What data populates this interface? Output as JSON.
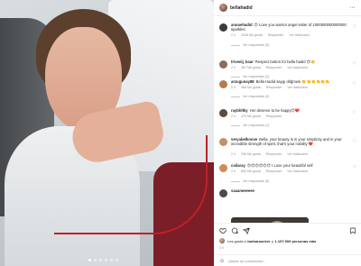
{
  "post": {
    "username": "bellahadid",
    "image_carousel": {
      "current": 1,
      "total": 6
    }
  },
  "colors": {
    "accent": "#0095f6",
    "muted": "#8e8e8e",
    "text": "#262626",
    "heart_red": "#ed4956"
  },
  "comments": [
    {
      "username": "anouehadid",
      "text": "😍 Love you warrior angel sister of 1000000000000000 sparkles",
      "time": "2 h",
      "likes": "2046 Me gusta",
      "reply": "Responder",
      "translate": "Ver traducción",
      "replies": "Ver respuestas (5)",
      "avatar_color": "#3b3b3b"
    },
    {
      "username": "trivenij_kaur",
      "text": "Respect button for bella hadid 😍👏",
      "time": "2 h",
      "likes": "487 Me gusta",
      "reply": "Responder",
      "translate": "Ver traducción",
      "replies": "Ver respuestas (2)",
      "avatar_color": "#8a6d5a"
    },
    {
      "username": "arzugunay88",
      "text": "Bella Hadid saygı döğmesi 👏👏👏👏👏👏",
      "time": "2 h",
      "likes": "468 Me gusta",
      "reply": "Responder",
      "translate": "Ver traducción",
      "replies": "Ver respuestas (2)",
      "avatar_color": "#b37b4e"
    },
    {
      "username": "raybhltky",
      "text": "Her deserve to be happy😍❤️",
      "time": "2 h",
      "likes": "476 Me gusta",
      "reply": "Responder",
      "translate": "",
      "replies": "Ver respuestas (1)",
      "avatar_color": "#5f4a3f"
    },
    {
      "username": "veryabelknove",
      "text": "Bella, your beauty is in your simplicity and in your incredible strength of spirit. that's your nobility ❤️",
      "time": "2 h",
      "likes": "258 Me gusta",
      "reply": "Responder",
      "translate": "Ver traducción",
      "replies": "",
      "avatar_color": "#c28f6f"
    },
    {
      "username": "coilaray",
      "text": "😍😍😍😍😍😍 I Love your beautiful self",
      "time": "2 h",
      "likes": "806 Me gusta",
      "reply": "Responder",
      "translate": "Ver traducción",
      "replies": "Ver respuestas (5)",
      "avatar_color": "#d08a5a"
    },
    {
      "username": "saaaneeeeee",
      "text": "",
      "time": "",
      "likes": "",
      "reply": "",
      "translate": "",
      "replies": "",
      "avatar_color": "#4b4b4b"
    }
  ],
  "footer": {
    "likes_prefix": "Les gusta a",
    "likes_user": "barbaraocker",
    "likes_middle": "y",
    "likes_count": "1.197.900 personas más",
    "date": "2 h",
    "add_comment_placeholder": "Añade un comentario..."
  },
  "icons": {
    "more": "more-horizontal-icon",
    "heart": "heart-icon",
    "comment": "comment-icon",
    "share": "share-icon",
    "save": "bookmark-icon",
    "emoji": "emoji-icon"
  }
}
